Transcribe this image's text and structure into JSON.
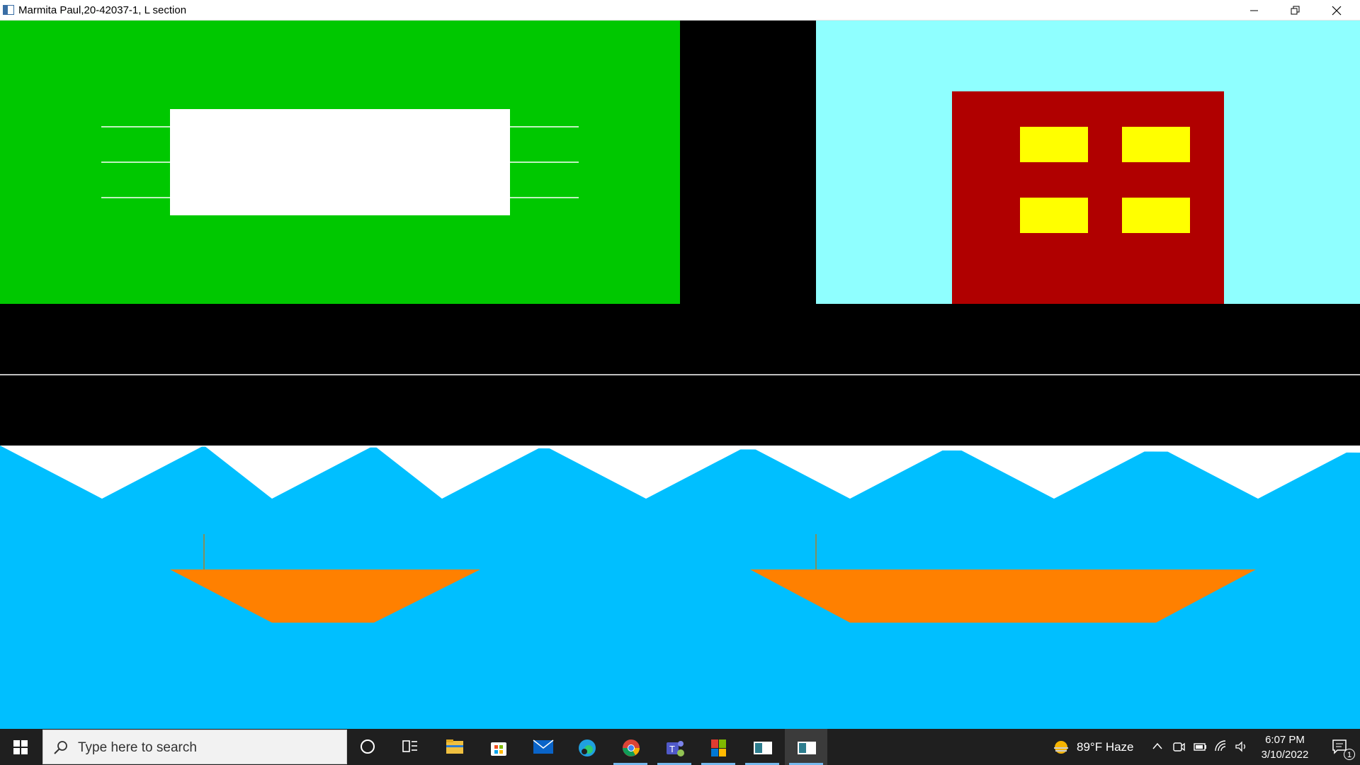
{
  "window": {
    "title": "Marmita Paul,20-42037-1, L section",
    "controls": {
      "minimize": "minimize",
      "maximize": "restore",
      "close": "close"
    }
  },
  "scene": {
    "colors": {
      "field": "#00c800",
      "road": "#000000",
      "sky": "#8fffff",
      "building": "#b00000",
      "window": "#ffff00",
      "water": "#00bfff",
      "wave_tips": "#ffffff",
      "boat": "#ff8000",
      "mast": "#7f8f5f",
      "road_line": "#ffffff",
      "sign": "#ffffff"
    },
    "building_windows": 4,
    "boats": 2
  },
  "taskbar": {
    "search_placeholder": "Type here to search",
    "icons": [
      "cortana-icon",
      "task-view-icon",
      "file-explorer-icon",
      "microsoft-store-icon",
      "mail-icon",
      "edge-icon",
      "chrome-icon",
      "teams-icon",
      "office-icon",
      "app-icon",
      "running-app-icon"
    ],
    "weather": {
      "temp": "89°F",
      "condition": "Haze"
    },
    "clock": {
      "time": "6:07 PM",
      "date": "3/10/2022"
    },
    "notifications_count": "1"
  }
}
